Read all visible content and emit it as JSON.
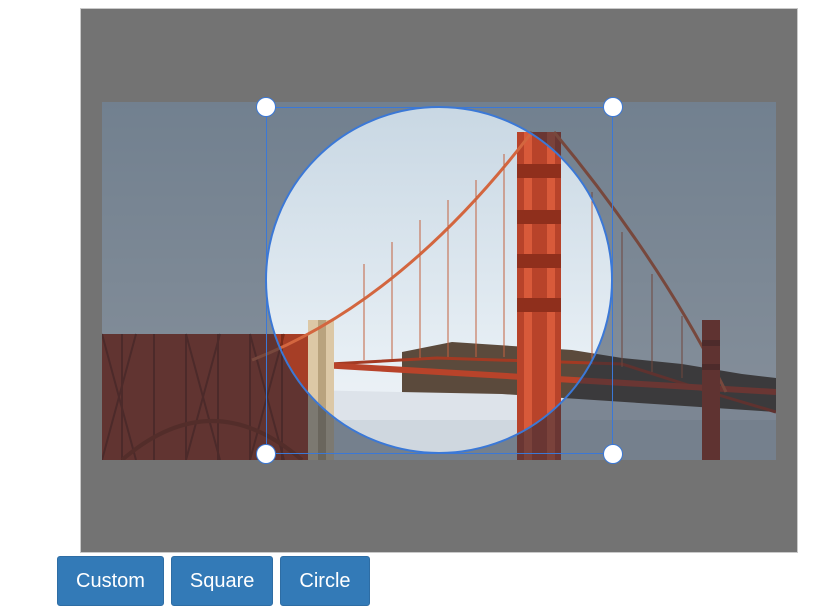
{
  "toolbar": {
    "buttons": [
      {
        "label": "Custom"
      },
      {
        "label": "Square"
      },
      {
        "label": "Circle"
      }
    ]
  },
  "colors": {
    "panel_background": "#737373",
    "button_background": "#337ab7",
    "crop_outline": "#3b78d6",
    "bridge": "#b8432a"
  },
  "crop": {
    "shape": "circle"
  }
}
